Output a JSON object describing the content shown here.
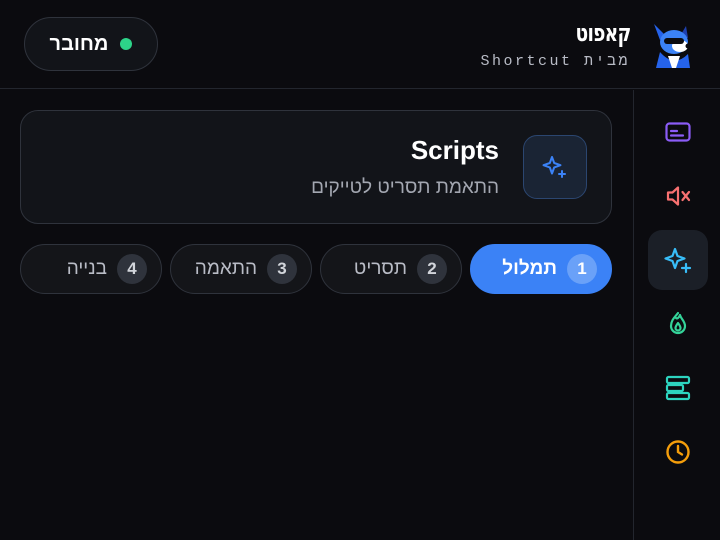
{
  "header": {
    "brand_logo": "קאפוט",
    "brand_subtitle": "מבית Shortcut",
    "status_label": "מחובר",
    "status_color": "#2dd489"
  },
  "sidebar": {
    "items": [
      {
        "icon": "subtitles-icon",
        "color": "#8b5cf6",
        "active": false
      },
      {
        "icon": "volume-mute-icon",
        "color": "#f87171",
        "active": false
      },
      {
        "icon": "sparkles-icon",
        "color": "#38bdf8",
        "active": true
      },
      {
        "icon": "flame-icon",
        "color": "#34d399",
        "active": false
      },
      {
        "icon": "timeline-bars-icon",
        "color": "#2dd4bf",
        "active": false
      },
      {
        "icon": "clock-icon",
        "color": "#f59e0b",
        "active": false
      }
    ]
  },
  "card": {
    "title": "Scripts",
    "subtitle": "התאמת תסריט לטייקים",
    "icon": "sparkles-plus-icon"
  },
  "steps": [
    {
      "number": "1",
      "label": "תמלול",
      "active": true
    },
    {
      "number": "2",
      "label": "תסריט",
      "active": false
    },
    {
      "number": "3",
      "label": "התאמה",
      "active": false
    },
    {
      "number": "4",
      "label": "בנייה",
      "active": false
    }
  ],
  "colors": {
    "accent": "#3b82f6",
    "background": "#0b0b0f"
  }
}
